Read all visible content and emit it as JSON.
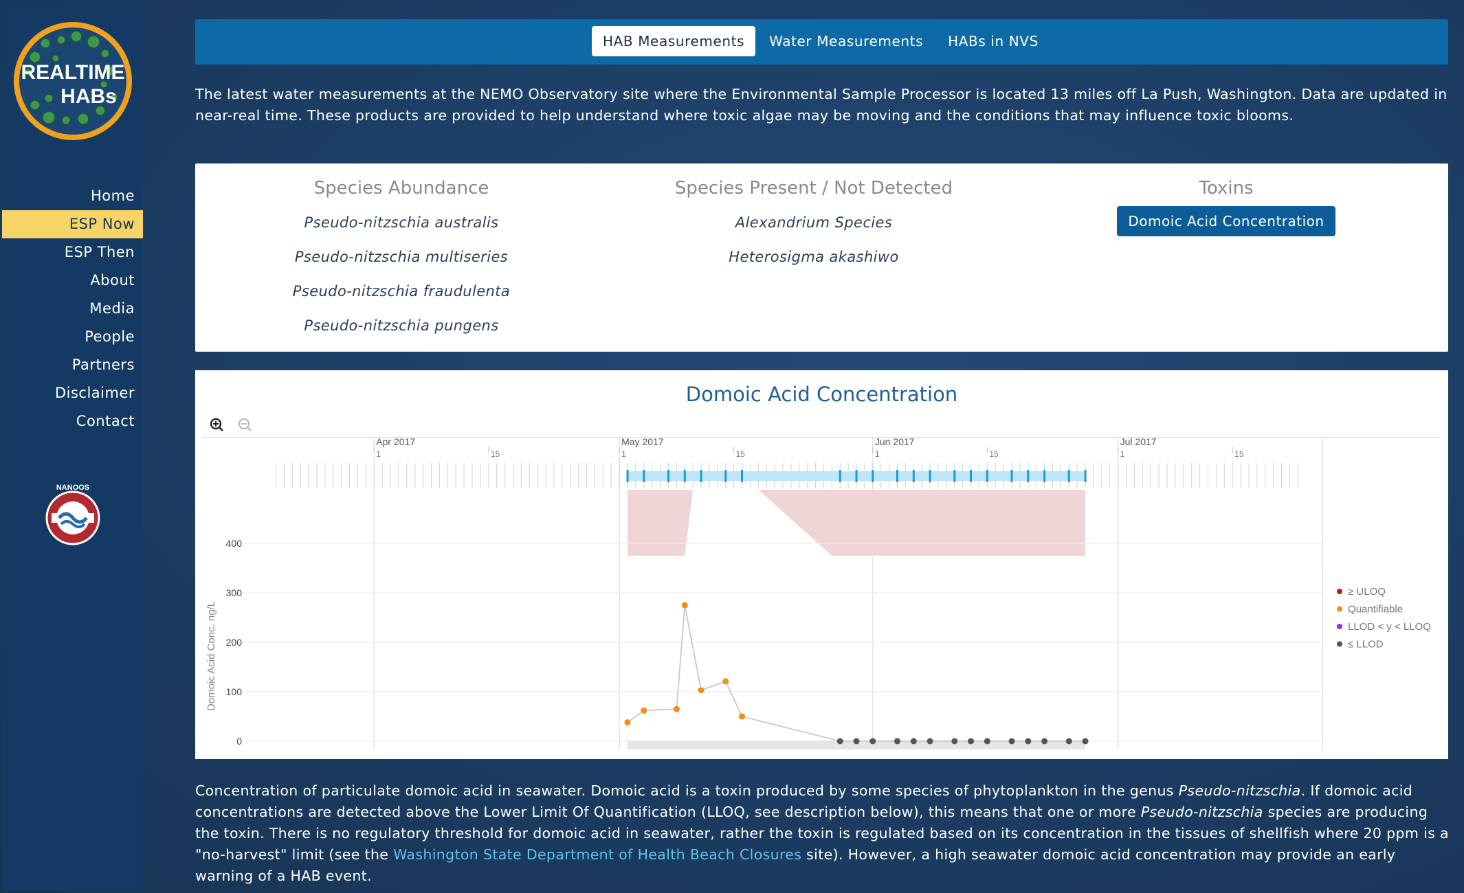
{
  "sidebar": {
    "logo": {
      "line1": "REALTIME",
      "line2": "HABs"
    },
    "nav": [
      "Home",
      "ESP Now",
      "ESP Then",
      "About",
      "Media",
      "People",
      "Partners",
      "Disclaimer",
      "Contact"
    ],
    "active_nav": "ESP Now",
    "partner_logo": {
      "text": "NANOOS"
    }
  },
  "tabs": [
    {
      "label": "HAB Measurements",
      "active": true
    },
    {
      "label": "Water Measurements",
      "active": false
    },
    {
      "label": "HABs in NVS",
      "active": false
    }
  ],
  "intro": "The latest water measurements at the NEMO Observatory site where the Environmental Sample Processor is located 13 miles off La Push, Washington. Data are updated in near-real time. These products are provided to help understand where toxic algae may be moving and the conditions that may influence toxic blooms.",
  "species_panel": {
    "abundance": {
      "heading": "Species Abundance",
      "items": [
        "Pseudo-nitzschia australis",
        "Pseudo-nitzschia multiseries",
        "Pseudo-nitzschia fraudulenta",
        "Pseudo-nitzschia pungens"
      ]
    },
    "present": {
      "heading": "Species Present / Not Detected",
      "items": [
        "Alexandrium Species",
        "Heterosigma akashiwo"
      ]
    },
    "toxins": {
      "heading": "Toxins",
      "button": "Domoic Acid Concentration"
    }
  },
  "chart_data": {
    "type": "scatter",
    "title": "Domoic Acid Concentration",
    "ylabel": "Domoic Acid Conc. ng/L",
    "ylim": [
      0,
      460
    ],
    "y_ticks": [
      0,
      100,
      200,
      300,
      400
    ],
    "x_range": [
      "2017-03-16",
      "2017-07-26"
    ],
    "month_labels": [
      {
        "date": "2017-04-01",
        "label": "Apr 2017"
      },
      {
        "date": "2017-05-01",
        "label": "May 2017"
      },
      {
        "date": "2017-06-01",
        "label": "Jun 2017"
      },
      {
        "date": "2017-07-01",
        "label": "Jul 2017"
      }
    ],
    "day_labels": [
      {
        "date": "2017-04-01",
        "label": "1"
      },
      {
        "date": "2017-04-15",
        "label": "15"
      },
      {
        "date": "2017-05-01",
        "label": "1"
      },
      {
        "date": "2017-05-15",
        "label": "15"
      },
      {
        "date": "2017-06-01",
        "label": "1"
      },
      {
        "date": "2017-06-15",
        "label": "15"
      },
      {
        "date": "2017-07-01",
        "label": "1"
      },
      {
        "date": "2017-07-15",
        "label": "15"
      }
    ],
    "legend_position": "right",
    "series": [
      {
        "name": "≥ ULOQ",
        "color": "#c0161b",
        "points": []
      },
      {
        "name": "Quantifiable",
        "color": "#f08f14",
        "points": [
          {
            "x": "2017-05-02",
            "y": 38
          },
          {
            "x": "2017-05-04",
            "y": 62
          },
          {
            "x": "2017-05-08",
            "y": 65
          },
          {
            "x": "2017-05-09",
            "y": 275
          },
          {
            "x": "2017-05-11",
            "y": 103
          },
          {
            "x": "2017-05-14",
            "y": 121
          },
          {
            "x": "2017-05-16",
            "y": 50
          }
        ]
      },
      {
        "name": "LLOD < y < LLOQ",
        "color": "#9b2ee8",
        "points": []
      },
      {
        "name": "≤ LLOD",
        "color": "#555555",
        "points": [
          {
            "x": "2017-05-28",
            "y": 0
          },
          {
            "x": "2017-05-30",
            "y": 0
          },
          {
            "x": "2017-06-01",
            "y": 0
          },
          {
            "x": "2017-06-04",
            "y": 0
          },
          {
            "x": "2017-06-06",
            "y": 0
          },
          {
            "x": "2017-06-08",
            "y": 0
          },
          {
            "x": "2017-06-11",
            "y": 0
          },
          {
            "x": "2017-06-13",
            "y": 0
          },
          {
            "x": "2017-06-15",
            "y": 0
          },
          {
            "x": "2017-06-18",
            "y": 0
          },
          {
            "x": "2017-06-20",
            "y": 0
          },
          {
            "x": "2017-06-22",
            "y": 0
          },
          {
            "x": "2017-06-25",
            "y": 0
          },
          {
            "x": "2017-06-27",
            "y": 0
          }
        ]
      }
    ],
    "navigator": {
      "selected_range": [
        "2017-05-02",
        "2017-06-27"
      ],
      "sample_dates": [
        "2017-05-02",
        "2017-05-04",
        "2017-05-07",
        "2017-05-09",
        "2017-05-11",
        "2017-05-14",
        "2017-05-16",
        "2017-05-28",
        "2017-05-30",
        "2017-06-01",
        "2017-06-04",
        "2017-06-06",
        "2017-06-08",
        "2017-06-11",
        "2017-06-13",
        "2017-06-15",
        "2017-06-18",
        "2017-06-20",
        "2017-06-22",
        "2017-06-25",
        "2017-06-27"
      ]
    },
    "grid": true,
    "zoom_controls": [
      "zoom-in-icon",
      "zoom-out-icon"
    ]
  },
  "description": {
    "part1": "Concentration of particulate domoic acid in seawater. Domoic acid is a toxin produced by some species of phytoplankton in the genus ",
    "genus1": "Pseudo-nitzschia",
    "part2": ". If domoic acid concentrations are detected above the Lower Limit Of Quantification (LLOQ, see description below), this means that one or more ",
    "genus2": "Pseudo-nitzschia",
    "part3": " species are producing the toxin. There is no regulatory threshold for domoic acid in seawater, rather the toxin is regulated based on its concentration in the tissues of shellfish where 20 ppm is a \"no-harvest\" limit (see the ",
    "link": "Washington State Department of Health Beach Closures",
    "part4": " site). However, a high seawater domoic acid concentration may provide an early warning of a HAB event."
  },
  "colors": {
    "sidebar_bg": "#143a64",
    "active_nav": "#f6d466",
    "tabbar": "#0e6aa6",
    "toxin_button": "#0c5d97",
    "chart_title": "#205f95",
    "link": "#5fc3f0"
  }
}
